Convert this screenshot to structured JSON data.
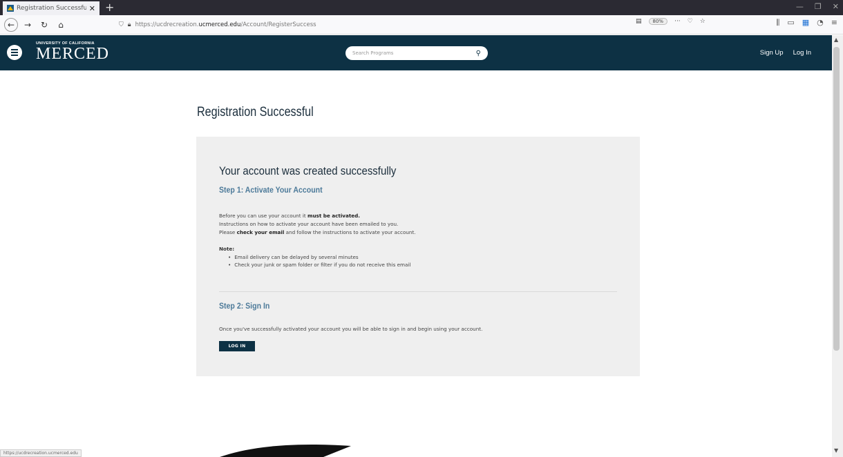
{
  "browser": {
    "tab_title": "Registration Successful - UC M",
    "new_tab": "+",
    "url_prefix": "https://ucdrecreation.",
    "url_host": "ucmerced.edu",
    "url_path": "/Account/RegisterSuccess",
    "zoom": "80%",
    "more": "···"
  },
  "header": {
    "logo_small": "UNIVERSITY OF CALIFORNIA",
    "logo_big": "MERCED",
    "search_placeholder": "Search Programs",
    "sign_up": "Sign Up",
    "log_in": "Log In"
  },
  "main": {
    "page_title": "Registration Successful",
    "card_heading": "Your account was created successfully",
    "step1_title": "Step 1: Activate Your Account",
    "line1_prefix": "Before you can use your account it ",
    "line1_bold": "must be activated.",
    "line2": "Instructions on how to activate your account have been emailed to you.",
    "line3_prefix": "Please ",
    "line3_bold": "check your email",
    "line3_suffix": " and follow the instructions to activate your account.",
    "note_label": "Note:",
    "notes": [
      "Email delivery can be delayed by several minutes",
      "Check your junk or spam folder or filter if you do not receive this email"
    ],
    "step2_title": "Step 2: Sign In",
    "step2_text": "Once you've successfully activated your account you will be able to sign in and begin using your account.",
    "login_button": "LOG IN"
  },
  "status_bar_url": "https://ucdrecreation.ucmerced.edu"
}
